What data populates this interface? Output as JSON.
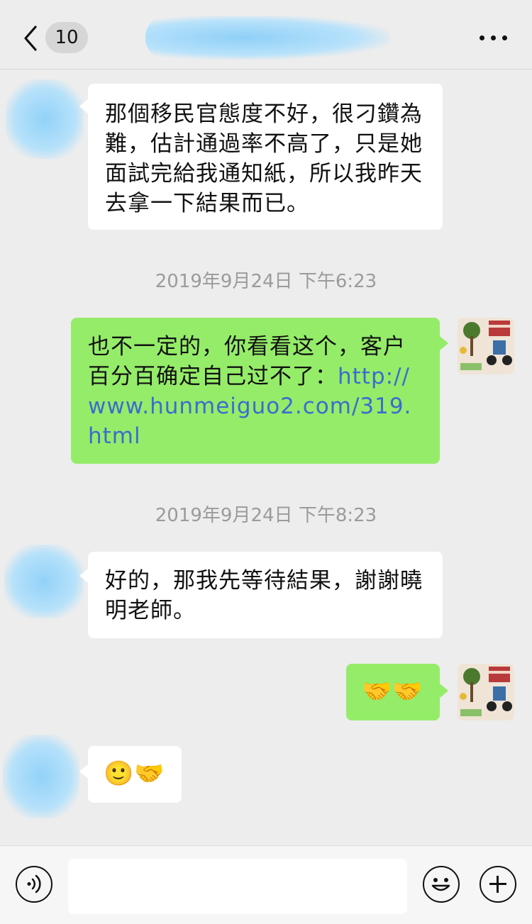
{
  "header": {
    "back_label": "<",
    "unread_count": "10",
    "chat_title": "",
    "more_label": "..."
  },
  "messages": [
    {
      "side": "in",
      "text": "那個移民官態度不好，很刁鑽為難，估計通過率不高了，只是她面試完給我通知紙，所以我昨天去拿一下結果而已。"
    },
    {
      "type": "time",
      "text": "2019年9月24日 下午6:23"
    },
    {
      "side": "out",
      "text_before_link": "也不一定的，你看看这个，客户百分百确定自己过不了：",
      "link": "http://www.hunmeiguo2.com/319.html"
    },
    {
      "type": "time",
      "text": "2019年9月24日 下午8:23"
    },
    {
      "side": "in",
      "text": "好的，那我先等待結果，謝謝曉明老師。"
    },
    {
      "side": "out",
      "emoji": "🤝🤝"
    },
    {
      "side": "in",
      "emoji": "🙂🤝"
    }
  ],
  "composer": {
    "placeholder": "",
    "voice_icon": "voice-icon",
    "emoji_icon": "smiley-icon",
    "plus_icon": "plus-icon"
  }
}
